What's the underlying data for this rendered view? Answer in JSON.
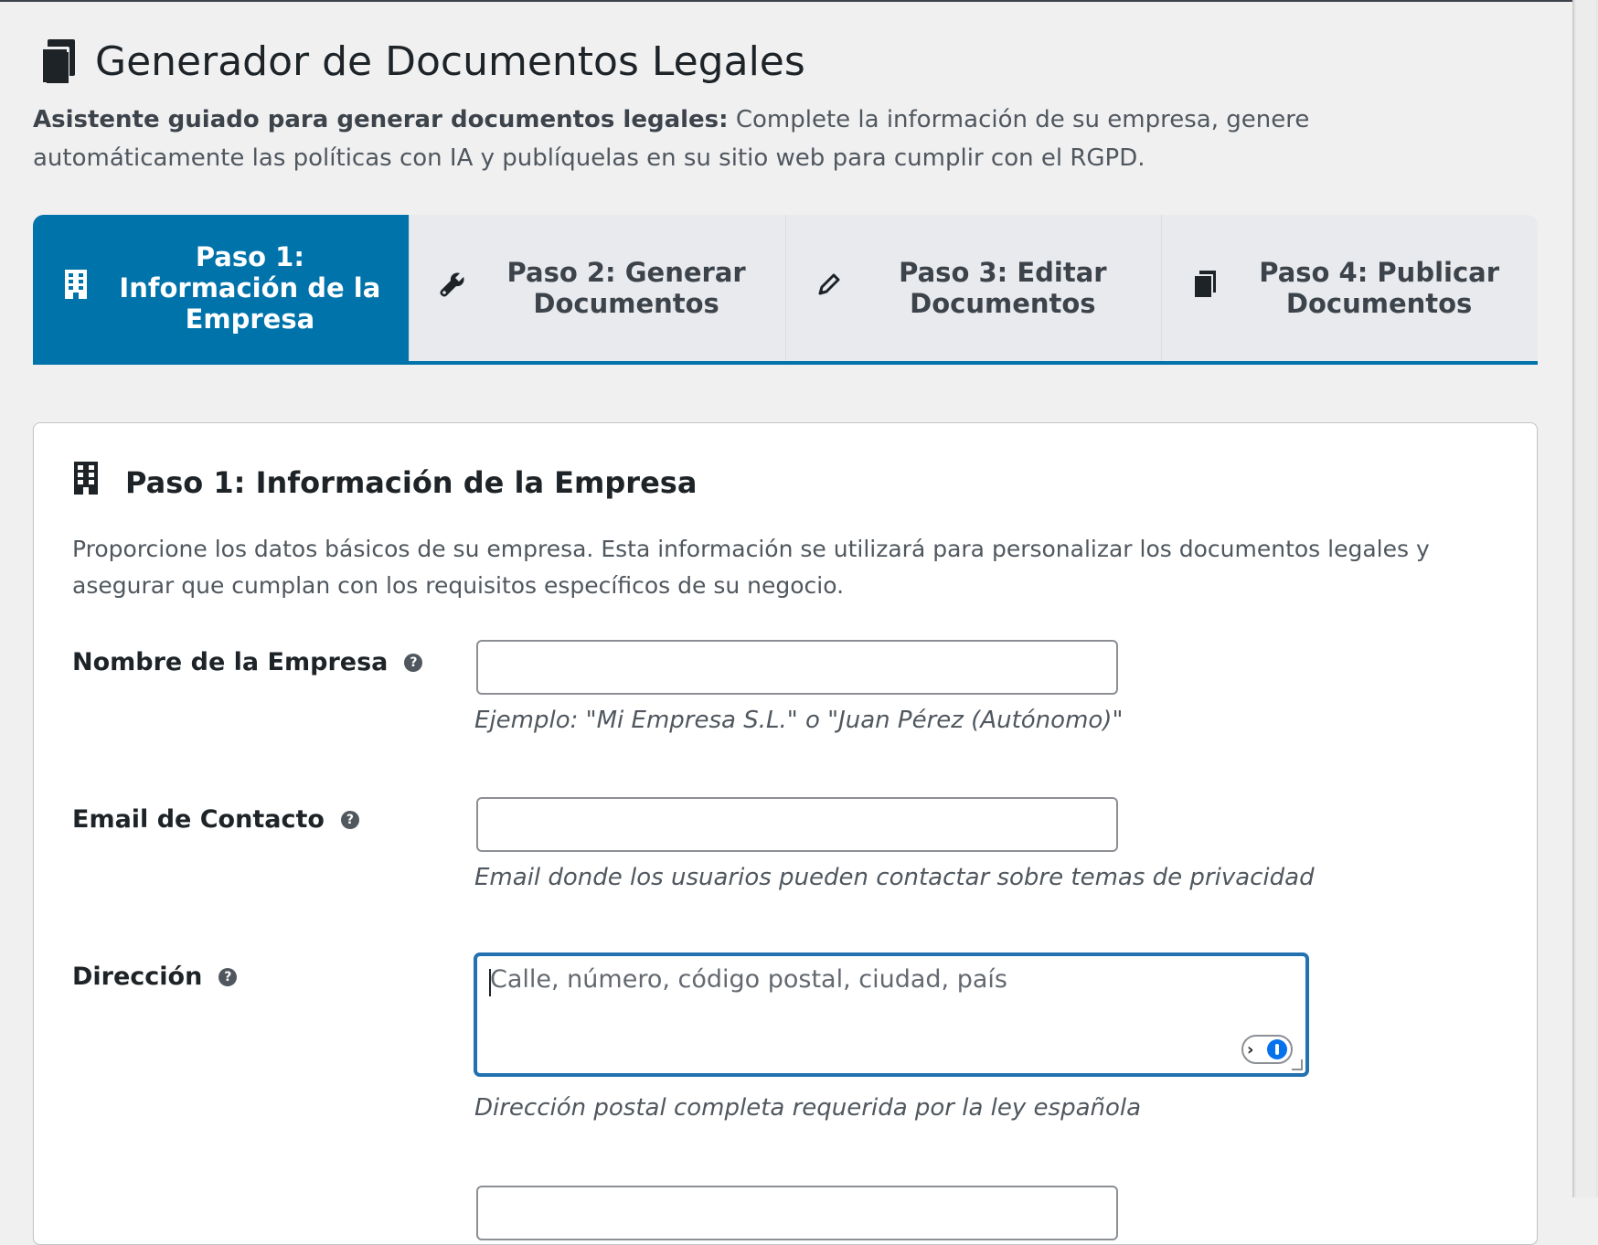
{
  "header": {
    "icon": "documents-icon",
    "title": "Generador de Documentos Legales",
    "intro_bold": "Asistente guiado para generar documentos legales:",
    "intro_text": " Complete la información de su empresa, genere automáticamente las políticas con IA y publíquelas en su sitio web para cumplir con el RGPD."
  },
  "tabs": [
    {
      "icon": "building-icon",
      "label": "Paso 1: Información de la Empresa",
      "active": true
    },
    {
      "icon": "wrench-icon",
      "label": "Paso 2: Generar Documentos",
      "active": false
    },
    {
      "icon": "pencil-icon",
      "label": "Paso 3: Editar Documentos",
      "active": false
    },
    {
      "icon": "documents-icon",
      "label": "Paso 4: Publicar Documentos",
      "active": false
    }
  ],
  "card": {
    "icon": "building-icon",
    "title": "Paso 1: Información de la Empresa",
    "description": "Proporcione los datos básicos de su empresa. Esta información se utilizará para personalizar los documentos legales y asegurar que cumplan con los requisitos específicos de su negocio."
  },
  "fields": {
    "company": {
      "label": "Nombre de la Empresa",
      "value": "",
      "hint": "Ejemplo: \"Mi Empresa S.L.\" o \"Juan Pérez (Autónomo)\""
    },
    "email": {
      "label": "Email de Contacto",
      "value": "",
      "hint": "Email donde los usuarios pueden contactar sobre temas de privacidad"
    },
    "address": {
      "label": "Dirección",
      "placeholder": "Calle, número, código postal, ciudad, país",
      "hint": "Dirección postal completa requerida por la ley española"
    }
  },
  "colors": {
    "accent": "#0073aa",
    "focus": "#2271b1",
    "background": "#f0f0f1"
  }
}
